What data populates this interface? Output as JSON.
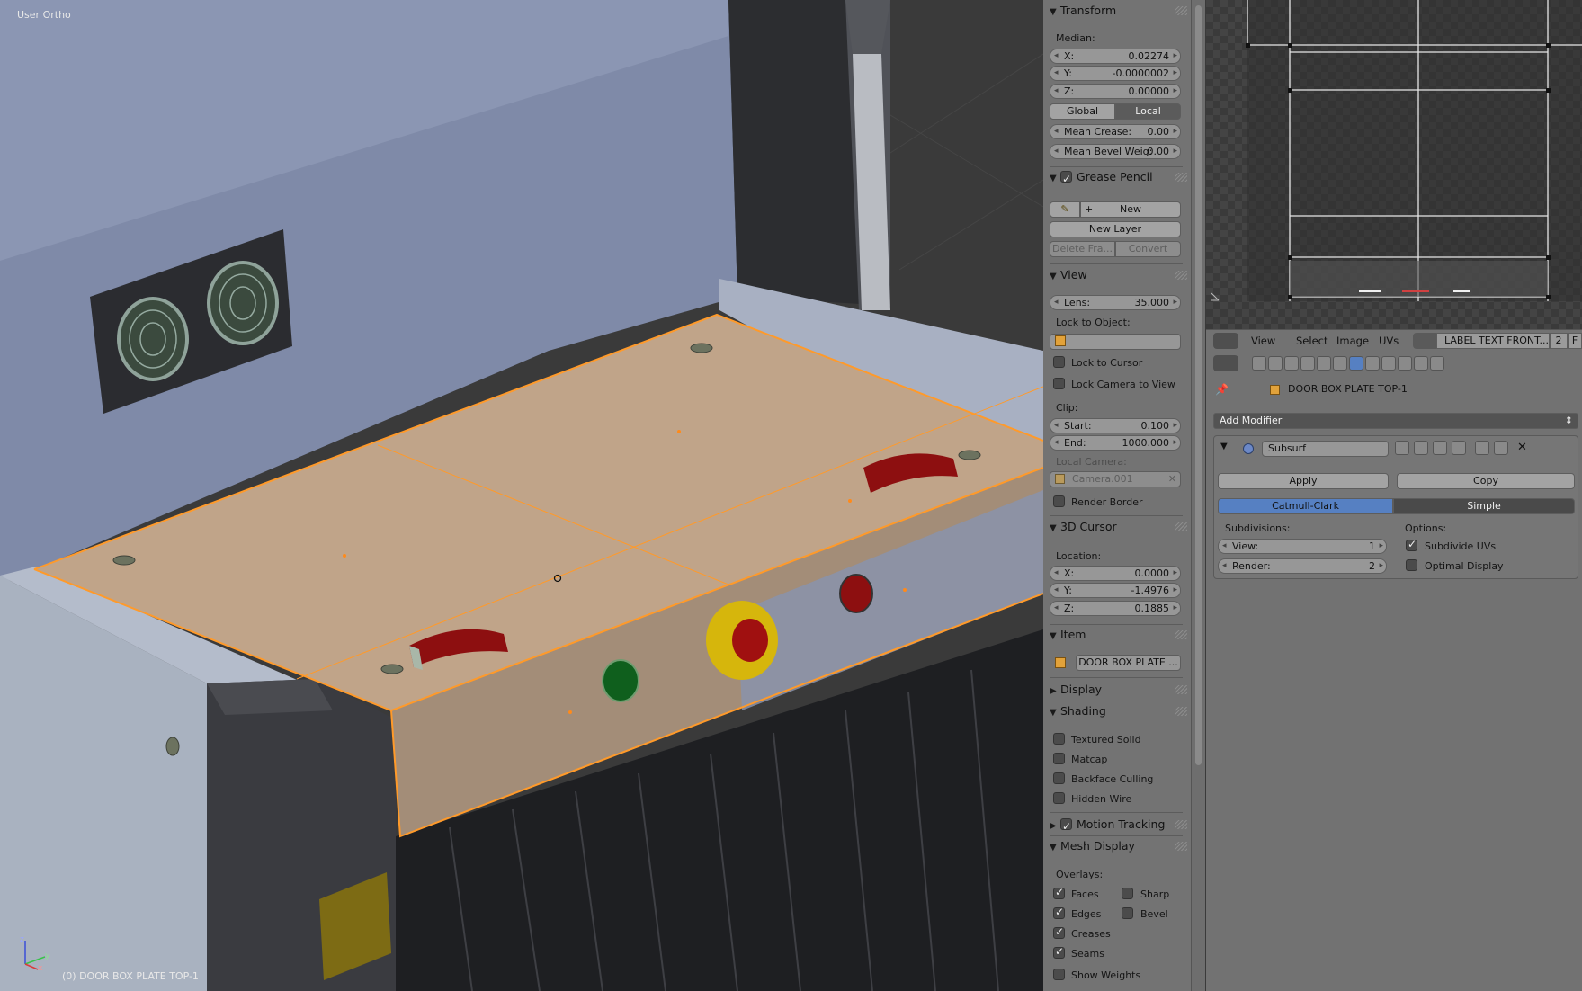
{
  "viewport": {
    "view_name": "User Ortho",
    "object_info": "(0) DOOR BOX PLATE TOP-1",
    "axis_labels": {
      "x": "x",
      "y": "y",
      "z": "z"
    }
  },
  "npanel": {
    "transform": {
      "title": "Transform",
      "median_label": "Median:",
      "x_label": "X:",
      "x": "0.02274",
      "y_label": "Y:",
      "y": "-0.0000002",
      "z_label": "Z:",
      "z": "0.00000",
      "global": "Global",
      "local": "Local",
      "mean_crease_label": "Mean Crease:",
      "mean_crease": "0.00",
      "mean_bevel_label": "Mean Bevel Weig:",
      "mean_bevel": "0.00"
    },
    "grease_pencil": {
      "title": "Grease Pencil",
      "enabled": true,
      "new": "New",
      "new_layer": "New Layer",
      "delete_frame": "Delete Fra...",
      "convert": "Convert"
    },
    "view": {
      "title": "View",
      "lens_label": "Lens:",
      "lens": "35.000",
      "lock_to_object": "Lock to Object:",
      "lock_to_cursor": "Lock to Cursor",
      "lock_camera": "Lock Camera to View",
      "clip": "Clip:",
      "start_label": "Start:",
      "start": "0.100",
      "end_label": "End:",
      "end": "1000.000",
      "local_camera": "Local Camera:",
      "camera": "Camera.001",
      "render_border": "Render Border"
    },
    "cursor": {
      "title": "3D Cursor",
      "location": "Location:",
      "x_label": "X:",
      "x": "0.0000",
      "y_label": "Y:",
      "y": "-1.4976",
      "z_label": "Z:",
      "z": "0.1885"
    },
    "item": {
      "title": "Item",
      "name": "DOOR BOX PLATE ..."
    },
    "display": {
      "title": "Display"
    },
    "shading": {
      "title": "Shading",
      "textured_solid": "Textured Solid",
      "matcap": "Matcap",
      "backface": "Backface Culling",
      "hidden_wire": "Hidden Wire"
    },
    "motion_tracking": {
      "title": "Motion Tracking",
      "enabled": true
    },
    "mesh_display": {
      "title": "Mesh Display",
      "overlays": "Overlays:",
      "faces": "Faces",
      "sharp": "Sharp",
      "edges": "Edges",
      "bevel": "Bevel",
      "creases": "Creases",
      "seams": "Seams",
      "show_weights": "Show Weights"
    }
  },
  "uv_header": {
    "menus": [
      "View",
      "Select",
      "Image",
      "UVs"
    ],
    "image_name": "LABEL TEXT FRONT...",
    "users": "2",
    "fake": "F"
  },
  "properties": {
    "object_name": "DOOR BOX PLATE TOP-1",
    "add_modifier": "Add Modifier",
    "modifier_name": "Subsurf",
    "apply": "Apply",
    "copy": "Copy",
    "catmull": "Catmull-Clark",
    "simple": "Simple",
    "subdivisions": "Subdivisions:",
    "view_label": "View:",
    "view_val": "1",
    "render_label": "Render:",
    "render_val": "2",
    "options": "Options:",
    "subdivide_uvs": "Subdivide UVs",
    "optimal_display": "Optimal Display"
  },
  "colors": {
    "selection": "#ff9a2a",
    "active_tab": "#5680c2"
  }
}
